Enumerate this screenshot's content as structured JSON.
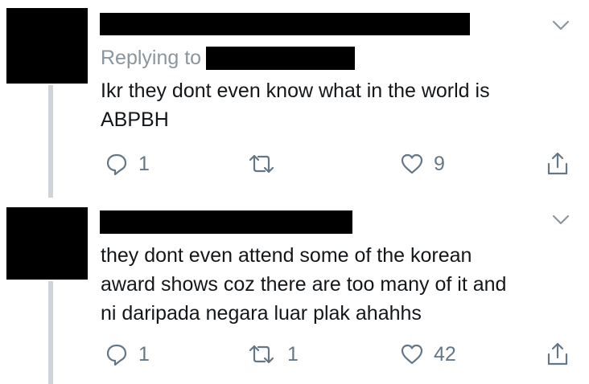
{
  "tweets": [
    {
      "replying_to_label": "Replying to",
      "text_lines": [
        "Ikr they dont even know what in the world is",
        "ABPBH"
      ],
      "reply_count": "1",
      "retweet_count": "",
      "like_count": "9"
    },
    {
      "replying_to_label": "",
      "text_lines": [
        "they dont even attend some of the korean",
        "award shows coz there are too many of it and",
        "ni daripada negara luar plak ahahhs"
      ],
      "reply_count": "1",
      "retweet_count": "1",
      "like_count": "42"
    }
  ],
  "colors": {
    "text": "#14171a",
    "muted": "#657786",
    "reply_label": "#8a959e",
    "thread_line": "#cfd4d8",
    "redaction": "#000000"
  },
  "icons": {
    "more": "chevron-down-icon",
    "reply": "reply-bubble-icon",
    "retweet": "retweet-icon",
    "like": "heart-icon",
    "share": "share-icon"
  }
}
